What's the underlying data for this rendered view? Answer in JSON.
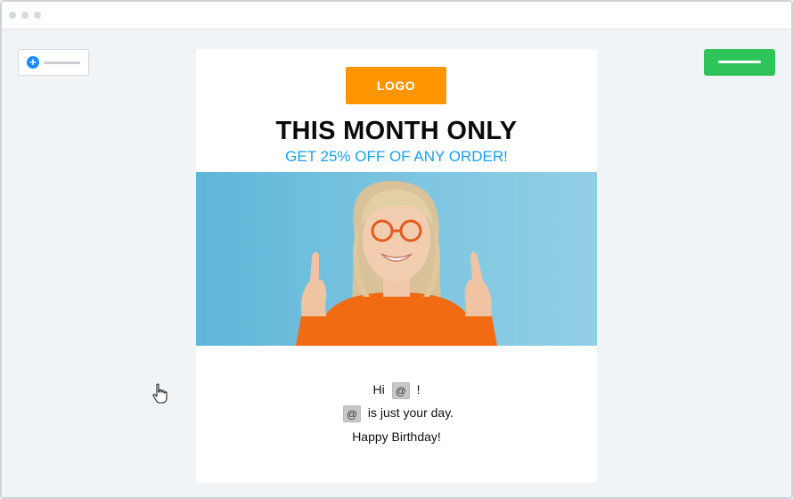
{
  "editor": {
    "add_block": {
      "icon": "plus-icon"
    },
    "save": {
      "color": "#2ec45a"
    }
  },
  "email": {
    "logo_label": "LOGO",
    "headline": "THIS MONTH ONLY",
    "subheadline": "GET 25% OFF OF ANY ORDER!",
    "hero_image": "woman-in-orange-sweater-pointing-up",
    "greeting_prefix": "Hi",
    "greeting_suffix": "!",
    "merge_tag": "@",
    "line2_suffix": "is just your day.",
    "line3": "Happy Birthday!"
  },
  "colors": {
    "logo": "#ff9500",
    "subheadline": "#1aa0ea",
    "accent": "#1a8cff"
  }
}
